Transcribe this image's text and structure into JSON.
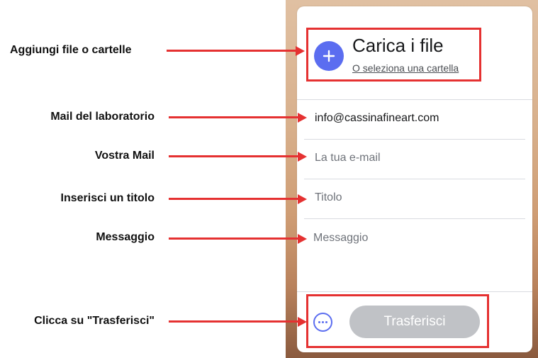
{
  "upload": {
    "title": "Carica i file",
    "subtitle": "O seleziona una cartella",
    "add_icon": "plus-icon",
    "accent": "#5b6df0"
  },
  "fields": {
    "to_email": "info@cassinafineart.com",
    "your_email_placeholder": "La tua e-mail",
    "title_placeholder": "Titolo",
    "message_placeholder": "Messaggio"
  },
  "footer": {
    "more_icon": "more-options-icon",
    "transfer_label": "Trasferisci"
  },
  "annotations": {
    "upload": "Aggiungi file o cartelle",
    "lab_mail": "Mail del laboratorio",
    "your_mail": "Vostra Mail",
    "title": "Inserisci un titolo",
    "message": "Messaggio",
    "transfer": "Clicca su \"Trasferisci\"",
    "arrow_color": "#e53131"
  }
}
